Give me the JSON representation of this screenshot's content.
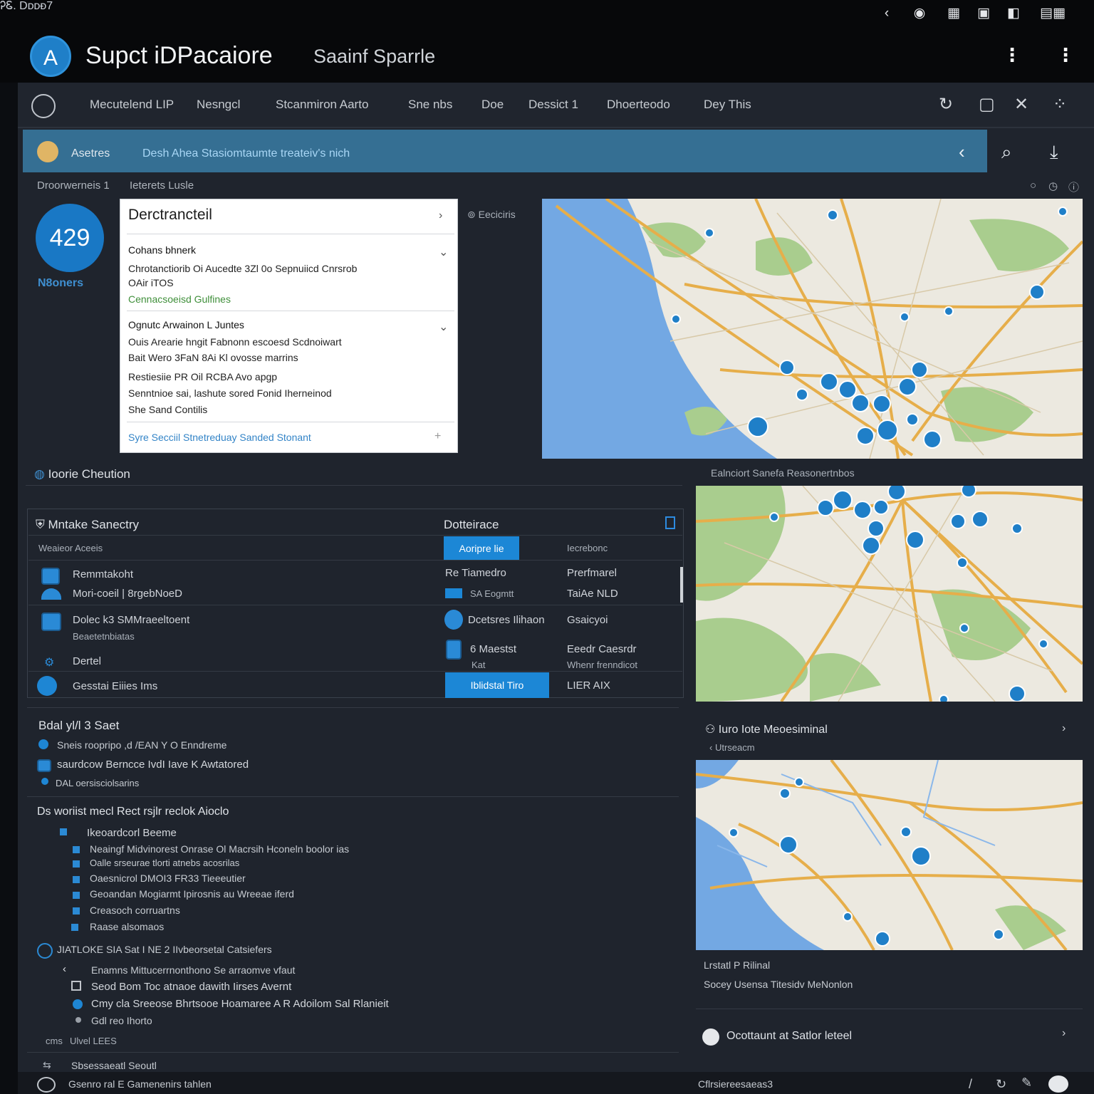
{
  "status": {
    "time": "ᎮᏋ. Dᴅᴅᴆ7",
    "icons": [
      "back-icon",
      "record-icon",
      "grid-icon",
      "image-icon",
      "tile-icon",
      "apps-icon"
    ]
  },
  "app": {
    "title": "Supct iDPacaiore",
    "subtitle": "Saainf Sparrle",
    "logo_glyph": "A"
  },
  "tabs": [
    "Mecutelend LIP",
    "Nesngcl",
    "Stcanmiron Aarto",
    "Sne nbs",
    "Doe",
    "Dessict 1",
    "Dhoerteodo",
    "Dey This"
  ],
  "banner": {
    "label": "Asetres",
    "text": "Desh Ahea Stasiomtaumte treateiv's nich"
  },
  "breadcrumb": {
    "left": "Droorwerneis 1",
    "right": "Ieterets Lusle"
  },
  "badge": {
    "value": "429",
    "label": "N8oners"
  },
  "detail_card": {
    "title": "Derctrancteil",
    "sections": [
      {
        "heading": "Cohans bhnerk",
        "lines": [
          "Chrotanctiorib Oi Aucedte 3Zl 0o Sepnuiicd Cnrsrob",
          "OAir iTOS"
        ],
        "note": "Cennacsoeisd Gulfines"
      },
      {
        "heading": "Ognutc Arwainon L Juntes",
        "lines": [
          "Ouis Arearie hngit  Fabnonn  escoesd Scdnoiwart",
          "Bait Wero 3FaN 8Ai Kl ovosse marrins",
          "Restiesiie PR Oil RCBA Avo apgp",
          "Senntnioe sai, lashute sored Fonid Iherneinod",
          "She Sand Contilis"
        ]
      }
    ],
    "footer_link": "Syre Secciil Stnetreduay Sanded Stonant"
  },
  "map_label": "Eeciciris",
  "location": {
    "heading": "Ioorie Cheution"
  },
  "table": {
    "left_header": "Mntake Sanectry",
    "right_header": "Dotteirace",
    "sub_left": "Weaieor Aceeis",
    "sub_action": "Aoripre lie",
    "sub_right": "Iecrebonc",
    "rows": [
      {
        "title": "Remmtakoht",
        "sub": "Mori-coeil | 8rgebNoeD",
        "mid1": "Re  Tiamedro",
        "mid2": "SA Eogmtt",
        "right1": "Prerfmarel",
        "right2": "TaiAe NLD"
      },
      {
        "title": "Dolec k3 SMMraeeltoent",
        "sub": "Beaetetnbiatas",
        "mid1": "Dcetsres Ilihaon",
        "mid2": "",
        "right1": "Gsaicyoi",
        "right2": ""
      },
      {
        "title": "Dertel",
        "sub": "",
        "mid1": "6 Maestst",
        "mid2": "Kat",
        "right1": "Eeedr Caesrdr",
        "right2": "Whenr  frenndicot"
      },
      {
        "title": "Gesstai Eiiies  Ims",
        "sub": "",
        "mid1": "Iblidstal Tiro",
        "mid2": "",
        "right1": "LIER AIX",
        "right2": ""
      }
    ]
  },
  "list1": {
    "heading": "Bdal yl/l 3 Saet",
    "items": [
      "Sneis  roopripo ,d  /EAN Y O Enndreme",
      "saurdcow Berncce IvdI Iave K Awtatored",
      "DAL oersisciolsarins"
    ]
  },
  "list2": {
    "heading": "Ds woriist mecl Rect rsjlr reclok Aioclo",
    "sub_heading": "Ikeoardcorl Beeme",
    "items": [
      "Neaingf Midvinorest Onrase Ol Macrsih Hconeln boolor ias",
      "Oalle srseurae tlorti  atnebs acosrilas",
      "Oaesnicrol  DMOI3 FR33  Tieeeutier",
      "Geoandan Mogiarmt Ipirosnis au Wreeae iferd",
      "Creasoch corruartns",
      "Raase alsomaos"
    ]
  },
  "list3": {
    "heading": "JIATLOKE SIA Sat I NE 2 IIvbeorsetal Catsiefers",
    "items": [
      "Enamns Mittucerrnonthono Se arraomve vfaut",
      "Seod Bom Toc atnaoe dawith Iirses Avernt",
      "Cmy  cla Sreeose Bhrtsooe Hoamaree  A  R  Adoilom Sal Rlanieit",
      "Gdl reo Ihorto"
    ],
    "foot_a": "cms",
    "foot_b": "Ulvel LEES",
    "foot_c": "Sbsessaeatl Seoutl"
  },
  "map2_label": "Ealnciort Sanefa Reasonertnbos",
  "panel_right": {
    "heading": "Iuro  Iote Meoesiminal",
    "back": "Utrseacm",
    "text1": "Lrstatl P Rilinal",
    "text2": "Socey Usensa Titesidv MeNonlon",
    "row_label": "Ocottaunt at Satlor leteel"
  },
  "footer": {
    "left": "Gsenro ral E Gamenenirs tahlen",
    "right": "Cflrsiereesaeas3"
  },
  "colors": {
    "accent": "#1c87d6",
    "banner": "#356f93",
    "water": "#6fa8e6",
    "land": "#ece9e0",
    "park": "#a9cd8e",
    "road": "#e6ae4a"
  }
}
